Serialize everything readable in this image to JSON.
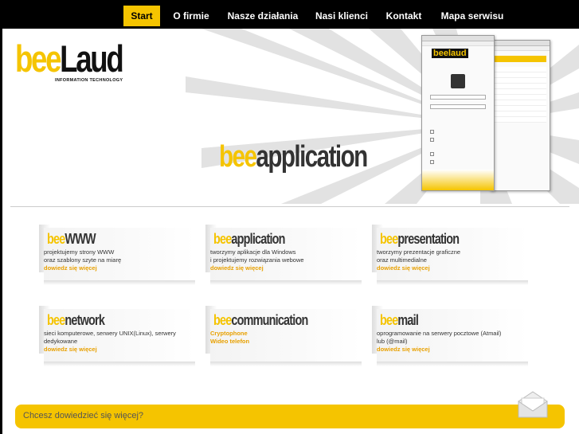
{
  "nav": {
    "items": [
      {
        "label": "Start",
        "active": true
      },
      {
        "label": "O firmie",
        "active": false
      },
      {
        "label": "Nasze działania",
        "active": false
      },
      {
        "label": "Nasi klienci",
        "active": false
      },
      {
        "label": "Kontakt",
        "active": false
      },
      {
        "label": "Mapa serwisu",
        "active": false
      }
    ]
  },
  "logo": {
    "bee": "bee",
    "laud": "Laud",
    "tagline": "INFORMATION TECHNOLOGY"
  },
  "banner": {
    "title_bee": "bee",
    "title_rest": "application"
  },
  "services": [
    {
      "bee": "bee",
      "name": "WWW",
      "lines": [
        "projektujemy strony WWW",
        "oraz szablony szyte na miarę"
      ],
      "links": [
        "dowiedz się więcej"
      ]
    },
    {
      "bee": "bee",
      "name": "application",
      "lines": [
        "tworzymy aplikacje dla Windows",
        "i projektujemy rozwiązania webowe"
      ],
      "links": [
        "dowiedz się więcej"
      ]
    },
    {
      "bee": "bee",
      "name": "presentation",
      "lines": [
        "tworzymy prezentacje graficzne",
        "oraz multimedialne"
      ],
      "links": [
        "dowiedz się więcej"
      ]
    },
    {
      "bee": "bee",
      "name": "network",
      "lines": [
        "sieci komputerowe, serwery UNIX(Linux), serwery",
        "dedykowane"
      ],
      "links": [
        "dowiedz się więcej"
      ]
    },
    {
      "bee": "bee",
      "name": "communication",
      "lines": [],
      "links": [
        "Cryptophone",
        "Wideo telefon"
      ]
    },
    {
      "bee": "bee",
      "name": "mail",
      "lines": [
        "oprogramowanie na serwery pocztowe (Atmail)",
        "lub (@mail)"
      ],
      "links": [
        "dowiedz się więcej"
      ]
    }
  ],
  "footer": {
    "text": "Chcesz dowiedzieć się więcej?"
  },
  "colors": {
    "accent": "#f5c400",
    "link": "#e8a000",
    "nav_bg": "#000000"
  }
}
